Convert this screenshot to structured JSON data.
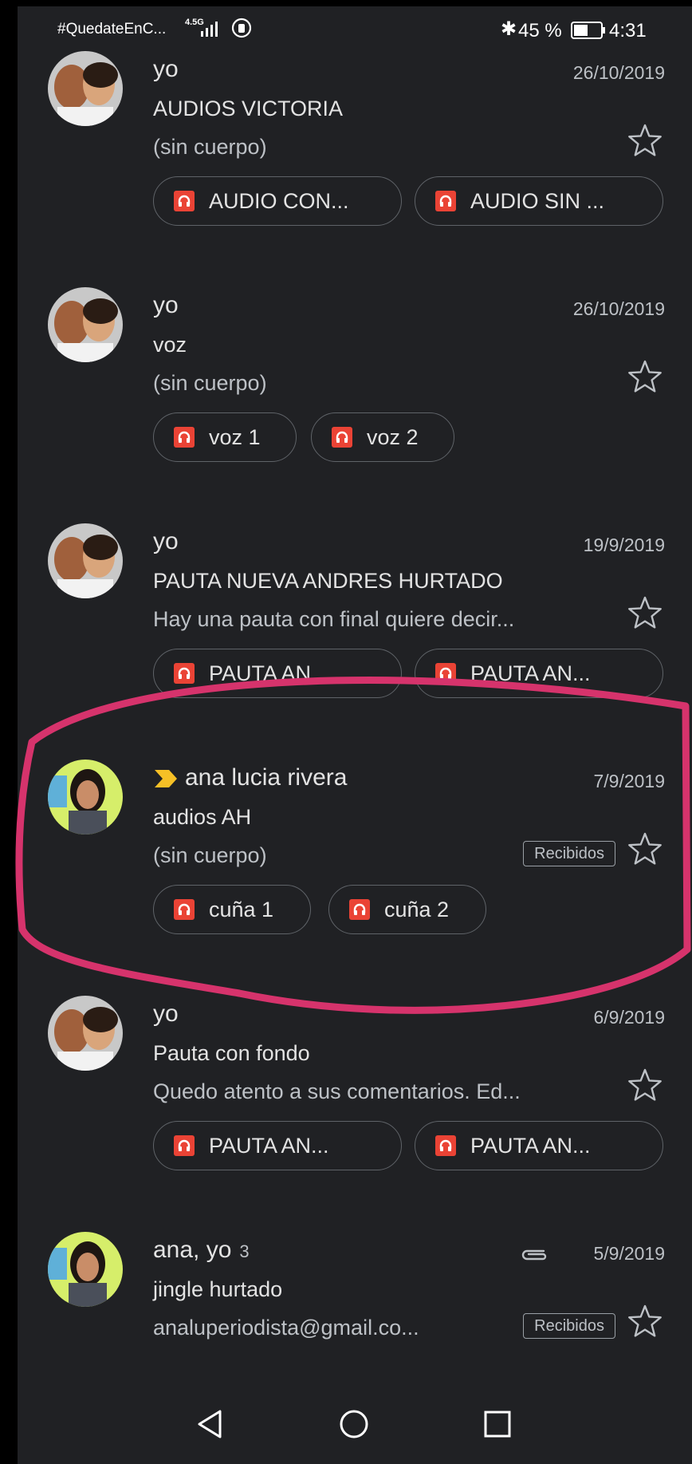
{
  "status_bar": {
    "carrier": "#QuedateEnC...",
    "network": "4.5G",
    "battery": "45 %",
    "time": "4:31"
  },
  "emails": [
    {
      "sender": "yo",
      "date": "26/10/2019",
      "subject": "AUDIOS VICTORIA",
      "snippet": "(sin cuerpo)",
      "attachments": [
        "AUDIO CON...",
        "AUDIO SIN ..."
      ],
      "starred": false,
      "avatar": "couple-photo"
    },
    {
      "sender": "yo",
      "date": "26/10/2019",
      "subject": "voz",
      "snippet": "(sin cuerpo)",
      "attachments": [
        "voz 1",
        "voz 2"
      ],
      "starred": false,
      "avatar": "couple-photo"
    },
    {
      "sender": "yo",
      "date": "19/9/2019",
      "subject": "PAUTA NUEVA ANDRES HURTADO",
      "snippet": "Hay una pauta con final quiere decir...",
      "attachments": [
        "PAUTA AN...",
        "PAUTA AN..."
      ],
      "starred": false,
      "avatar": "couple-photo"
    },
    {
      "sender": "ana lucia rivera",
      "date": "7/9/2019",
      "subject": "audios AH",
      "snippet": "(sin cuerpo)",
      "label": "Recibidos",
      "important": true,
      "attachments": [
        "cuña 1",
        "cuña 2"
      ],
      "starred": false,
      "avatar": "woman-photo"
    },
    {
      "sender": "yo",
      "date": "6/9/2019",
      "subject": "Pauta con fondo",
      "snippet": "Quedo atento a sus comentarios. Ed...",
      "attachments": [
        "PAUTA AN...",
        "PAUTA AN..."
      ],
      "starred": false,
      "avatar": "couple-photo"
    },
    {
      "sender": "ana, yo",
      "thread_count": "3",
      "date": "5/9/2019",
      "subject": "jingle hurtado",
      "snippet": "analuperiodista@gmail.co...",
      "label": "Recibidos",
      "has_attachment_icon": true,
      "starred": false,
      "avatar": "woman-photo"
    }
  ],
  "colors": {
    "background": "#202124",
    "attachment_icon": "#ea4335",
    "highlight": "#d6336c",
    "importance_marker": "#f6c026"
  },
  "nav_bar": {
    "icons": [
      "back-icon",
      "home-icon",
      "recents-icon"
    ]
  }
}
